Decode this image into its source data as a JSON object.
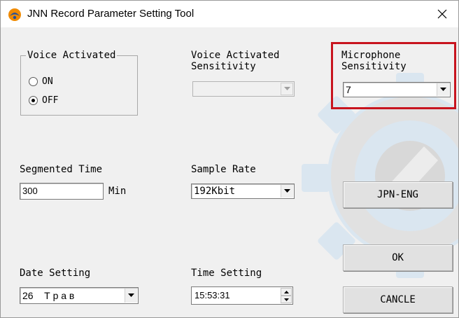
{
  "window": {
    "title": "JNN Record Parameter Setting Tool",
    "close_symbol": "✕"
  },
  "voice_activated": {
    "group_label": "Voice Activated",
    "options": [
      {
        "label": "ON",
        "selected": false
      },
      {
        "label": "OFF",
        "selected": true
      }
    ]
  },
  "voice_activated_sensitivity": {
    "label": "Voice Activated\nSensitivity",
    "value": "",
    "enabled": false
  },
  "microphone_sensitivity": {
    "label": "Microphone\nSensitivity",
    "value": "7",
    "highlighted": true,
    "highlight_color": "#c8141e"
  },
  "segmented_time": {
    "label": "Segmented Time",
    "value": "300",
    "unit": "Min"
  },
  "sample_rate": {
    "label": "Sample Rate",
    "value": "192Kbit"
  },
  "date_setting": {
    "label": "Date Setting",
    "value": "26    Т р а в"
  },
  "time_setting": {
    "label": "Time Setting",
    "value": "15:53:31"
  },
  "buttons": {
    "language": "JPN-ENG",
    "ok": "OK",
    "cancel": "CANCLE"
  },
  "icons": {
    "app": "jnn-app-icon",
    "close": "close-icon",
    "dropdown": "chevron-down-icon",
    "spin_up": "spin-up-icon",
    "spin_down": "spin-down-icon",
    "watermark": "watermark-logo"
  }
}
